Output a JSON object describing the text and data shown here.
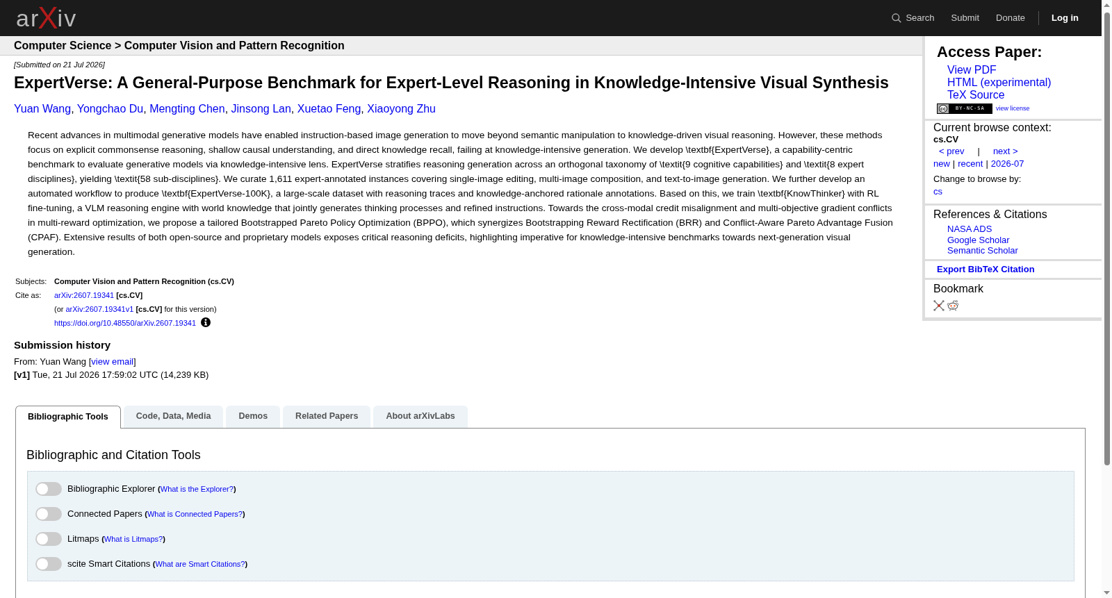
{
  "header": {
    "logo": "arXiv",
    "nav": [
      {
        "kind": "search",
        "label": "Search"
      },
      {
        "kind": "link",
        "label": "Submit"
      },
      {
        "kind": "link",
        "label": "Donate"
      },
      {
        "kind": "login",
        "label": "Log in"
      }
    ]
  },
  "breadcrumb": "Computer Science > Computer Vision and Pattern Recognition",
  "paper": {
    "submitted": "[Submitted on 21 Jul 2026]",
    "title": "ExpertVerse: A General-Purpose Benchmark for Expert-Level Reasoning in Knowledge-Intensive Visual Synthesis",
    "authors": {
      "names": [
        "Yuan Wang",
        "Yongchao Du",
        "Mengting Chen",
        "Jinsong Lan",
        "Xuetao Feng",
        "Xiaoyong Zhu"
      ],
      "separator": ","
    },
    "abstract": "Recent advances in multimodal generative models have enabled instruction-based image generation to move beyond semantic manipulation to knowledge-driven visual reasoning. However, these methods focus on explicit commonsense reasoning, shallow causal understanding, and direct knowledge recall, failing at knowledge-intensive generation. We develop \\textbf{ExpertVerse}, a capability-centric benchmark to evaluate generative models via knowledge-intensive lens. ExpertVerse stratifies reasoning generation across an orthogonal taxonomy of \\textit{9 cognitive capabilities} and \\textit{8 expert disciplines}, yielding \\textit{58 sub-disciplines}. We curate 1,611 expert-annotated instances covering single-image editing, multi-image composition, and text-to-image generation. We further develop an automated workflow to produce \\textbf{ExpertVerse-100K}, a large-scale dataset with reasoning traces and knowledge-anchored rationale annotations. Based on this, we train \\textbf{KnowThinker} with RL fine-tuning, a VLM reasoning engine with world knowledge that jointly generates thinking processes and refined instructions. Towards the cross-modal credit misalignment and multi-objective gradient conflicts in multi-reward optimization, we propose a tailored Bootstrapped Pareto Policy Optimization (BPPO), which synergizes Bootstrapping Reward Rectification (BRR) and Conflict-Aware Pareto Advantage Fusion (CPAF). Extensive results of both open-source and proprietary models exposes critical reasoning deficits, highlighting imperative for knowledge-intensive benchmarks towards next-generation visual generation."
  },
  "subjects": {
    "label": "Subjects:",
    "value": "Computer Vision and Pattern Recognition (cs.CV)"
  },
  "cite": {
    "label": "Cite as:",
    "lines": [
      {
        "link": "arXiv:2607.19341",
        "after": " **[cs.CV]**"
      },
      {
        "before": "(or ",
        "link": "arXiv:2607.19341v1",
        "after": " **[cs.CV]** for this version)"
      },
      {
        "link": "https://doi.org/10.48550/arXiv.2607.19341",
        "info": true
      }
    ]
  },
  "history": {
    "title": "Submission history",
    "from": {
      "before": "From: Yuan Wang [",
      "link": "view email",
      "after": "]"
    },
    "versions": [
      "**[v1]** Tue, 21 Jul 2026 17:59:02 UTC (14,239 KB)"
    ]
  },
  "sidebar": {
    "access": {
      "title": "Access Paper:",
      "links": [
        "View PDF",
        "HTML (experimental)",
        "TeX Source"
      ],
      "license": {
        "badge": [
          "cc",
          "BY-NC-SA"
        ],
        "link": "view license"
      }
    },
    "browse": {
      "title": "Current browse context:",
      "context": "cs.CV",
      "pager": [
        "< prev",
        "next >"
      ],
      "lists": [
        "new",
        "recent",
        "2026-07"
      ],
      "separator": "|",
      "change_label": "Change to browse by:",
      "change_links": [
        "cs"
      ]
    },
    "references": {
      "title": "References & Citations",
      "links": [
        "NASA ADS",
        "Google Scholar",
        "Semantic Scholar"
      ]
    },
    "export": "Export BibTeX Citation",
    "bookmark": {
      "title": "Bookmark"
    }
  },
  "tabs": {
    "items": [
      {
        "label": "Bibliographic Tools",
        "selected": true
      },
      {
        "label": "Code, Data, Media",
        "selected": false
      },
      {
        "label": "Demos",
        "selected": false
      },
      {
        "label": "Related Papers",
        "selected": false
      },
      {
        "label": "About arXivLabs",
        "selected": false
      }
    ]
  },
  "labs": {
    "title": "Bibliographic and Citation Tools",
    "brackets": [
      "(",
      ")"
    ],
    "tools": [
      {
        "label": "Bibliographic Explorer",
        "link": "What is the Explorer?",
        "on": false
      },
      {
        "label": "Connected Papers",
        "link": "What is Connected Papers?",
        "on": false
      },
      {
        "label": "Litmaps",
        "link": "What is Litmaps?",
        "on": false
      },
      {
        "label": "scite Smart Citations",
        "link": "What are Smart Citations?",
        "on": false
      }
    ]
  }
}
